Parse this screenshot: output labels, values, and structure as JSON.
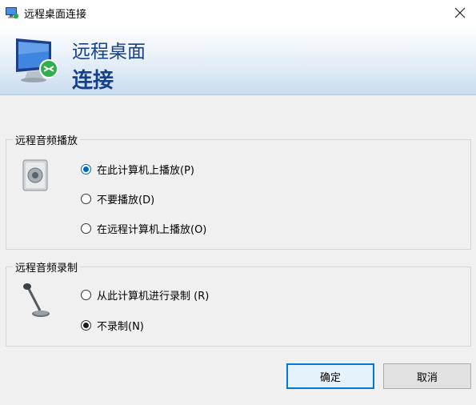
{
  "window": {
    "title": "远程桌面连接",
    "close_label": "×"
  },
  "banner": {
    "line1": "远程桌面",
    "line2": "连接"
  },
  "playback_group": {
    "label": "远程音频播放",
    "options": [
      {
        "label": "在此计算机上播放(P)",
        "checked": true
      },
      {
        "label": "不要播放(D)",
        "checked": false
      },
      {
        "label": "在远程计算机上播放(O)",
        "checked": false
      }
    ]
  },
  "recording_group": {
    "label": "远程音频录制",
    "options": [
      {
        "label": "从此计算机进行录制 (R)",
        "checked": false
      },
      {
        "label": "不录制(N)",
        "checked": true
      }
    ]
  },
  "buttons": {
    "ok": "确定",
    "cancel": "取消"
  },
  "colors": {
    "accent": "#0078d7",
    "banner_text": "#16408c"
  }
}
